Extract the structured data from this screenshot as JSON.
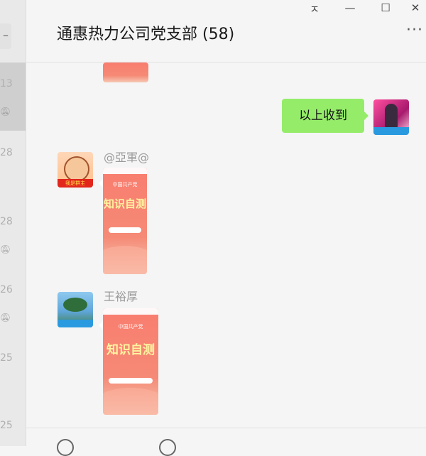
{
  "window": {
    "pin_icon": "pin-icon",
    "minimize_icon": "minimize-icon",
    "maximize_icon": "maximize-icon",
    "close_icon": "close-icon",
    "pin_glyph": "ㅈ",
    "min_glyph": "—",
    "max_glyph": "☐",
    "close_glyph": "✕"
  },
  "chat": {
    "title": "通惠热力公司党支部 (58)",
    "more_glyph": "···"
  },
  "left_list": {
    "times": [
      "13",
      "28",
      "28",
      "26",
      "25",
      "25"
    ]
  },
  "messages": [
    {
      "sender": "self",
      "text": "以上收到"
    },
    {
      "sender": "@亞軍@",
      "type": "card"
    },
    {
      "sender": "王裕厚",
      "type": "card"
    }
  ],
  "card": {
    "title_small": "中国共产党",
    "big_text": "知识自测"
  },
  "avatars": {
    "red_label": "我是群主"
  },
  "colors": {
    "bubble_self": "#95ec69",
    "card": "#f97d6f"
  }
}
